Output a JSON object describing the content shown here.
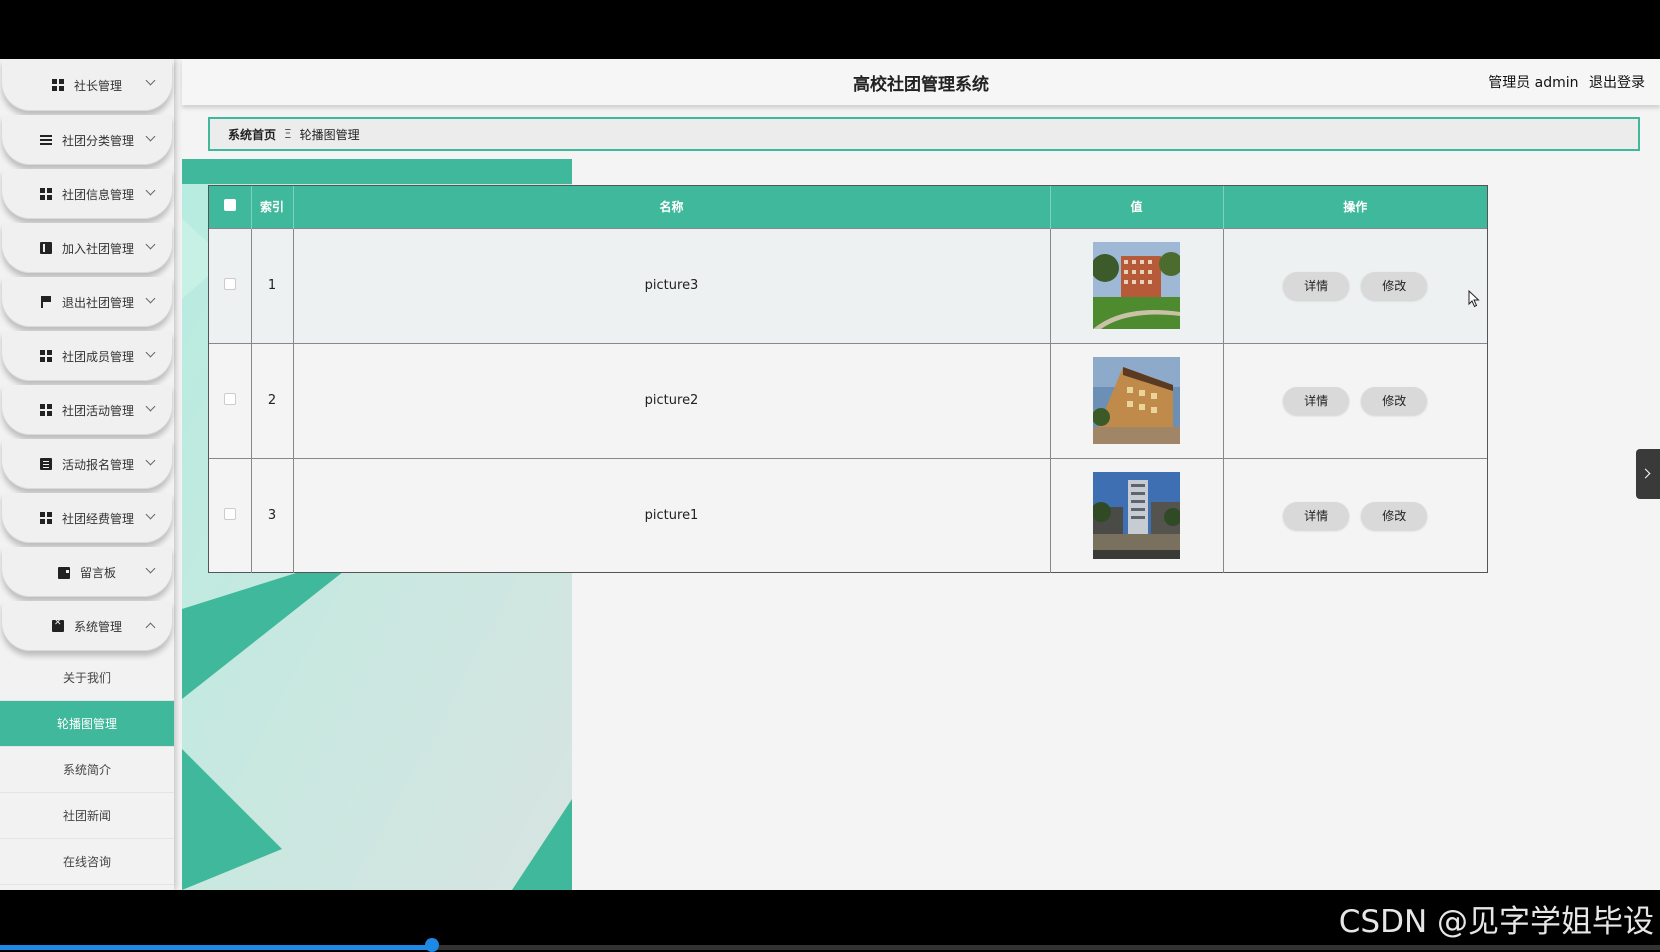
{
  "app": {
    "title": "高校社团管理系统",
    "user_label": "管理员 admin",
    "logout_label": "退出登录"
  },
  "sidebar": {
    "menus": [
      {
        "label": "社长管理",
        "icon": "grid-icon"
      },
      {
        "label": "社团分类管理",
        "icon": "list-icon"
      },
      {
        "label": "社团信息管理",
        "icon": "grid-icon"
      },
      {
        "label": "加入社团管理",
        "icon": "book-icon"
      },
      {
        "label": "退出社团管理",
        "icon": "flag-icon"
      },
      {
        "label": "社团成员管理",
        "icon": "grid-icon"
      },
      {
        "label": "社团活动管理",
        "icon": "grid-icon"
      },
      {
        "label": "活动报名管理",
        "icon": "clipboard-icon"
      },
      {
        "label": "社团经费管理",
        "icon": "grid-icon"
      },
      {
        "label": "留言板",
        "icon": "wallet-icon"
      },
      {
        "label": "系统管理",
        "icon": "document-icon"
      }
    ],
    "submenu": [
      {
        "label": "关于我们"
      },
      {
        "label": "轮播图管理"
      },
      {
        "label": "系统简介"
      },
      {
        "label": "社团新闻"
      },
      {
        "label": "在线咨询"
      }
    ]
  },
  "breadcrumb": {
    "home": "系统首页",
    "separator": "Ξ",
    "current": "轮播图管理"
  },
  "table": {
    "columns": [
      "索引",
      "名称",
      "值",
      "操作"
    ],
    "rows": [
      {
        "index": "1",
        "name": "picture3",
        "image": "campus-lawn-building-image"
      },
      {
        "index": "2",
        "name": "picture2",
        "image": "campus-building-sunset-image"
      },
      {
        "index": "3",
        "name": "picture1",
        "image": "campus-tower-courtyard-image"
      }
    ],
    "detail_label": "详情",
    "edit_label": "修改"
  },
  "footer": {
    "watermark": "CSDN @见字学姐毕设",
    "video_progress_pct": 26
  },
  "colors": {
    "accent": "#40b89b"
  }
}
